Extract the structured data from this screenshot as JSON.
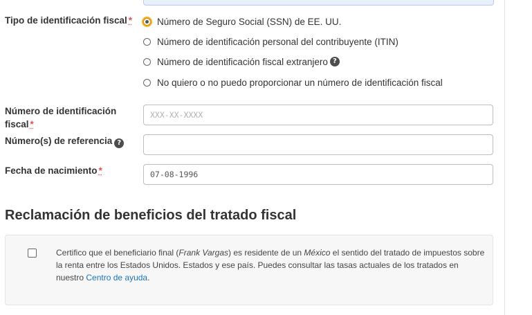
{
  "tax_id_type": {
    "label": "Tipo de identificación fiscal",
    "required_mark": "*",
    "options": [
      {
        "label": "Número de Seguro Social (SSN) de EE. UU.",
        "selected": true
      },
      {
        "label": "Número de identificación personal del contribuyente (ITIN)",
        "selected": false
      },
      {
        "label": "Número de identificación fiscal extranjero",
        "selected": false,
        "help_icon": "?"
      },
      {
        "label": "No quiero o no puedo proporcionar un número de identificación fiscal",
        "selected": false
      }
    ]
  },
  "tax_id_number": {
    "label_line1": "Número de identificación",
    "label_line2": "fiscal",
    "required_mark": "*",
    "value": "",
    "placeholder": "XXX-XX-XXXX"
  },
  "reference_numbers": {
    "label": "Número(s) de referencia",
    "help_icon": "?",
    "value": ""
  },
  "birth_date": {
    "label": "Fecha de nacimiento",
    "required_mark": "*",
    "value": "07-08-1996"
  },
  "treaty": {
    "title": "Reclamación de beneficios del tratado fiscal",
    "checked": false,
    "text_1": "Certifico que el beneficiario final (",
    "owner_name": "Frank Vargas",
    "text_2": ") es residente de un ",
    "country": "México",
    "text_3": " el sentido del tratado de impuestos sobre la renta entre los Estados Unidos. Estados y ese país. Puedes consultar las tasas actuales de los tratados en nuestro ",
    "help_link": "Centro de ayuda",
    "text_4": "."
  }
}
